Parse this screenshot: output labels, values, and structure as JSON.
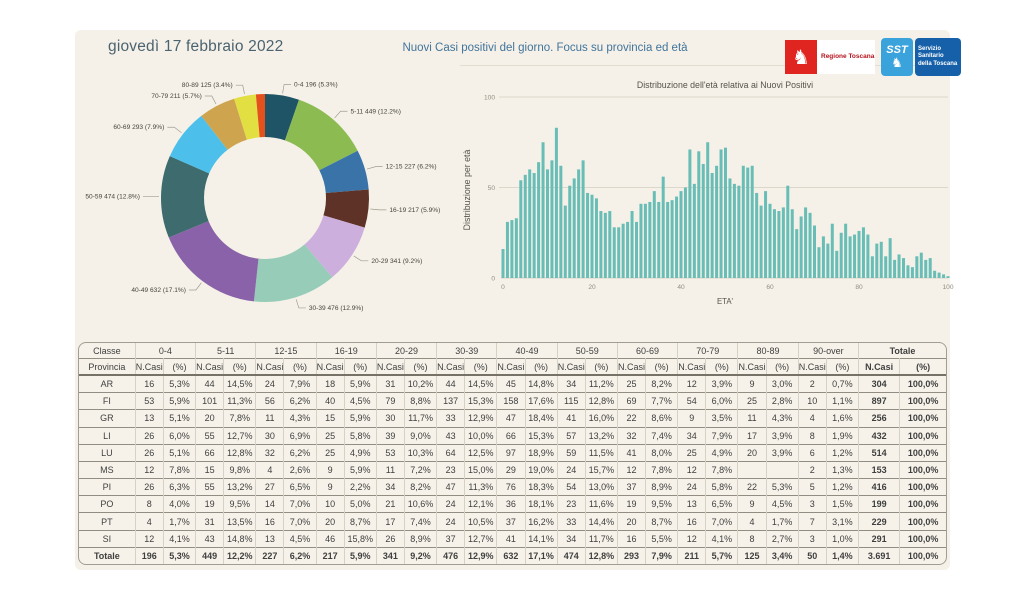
{
  "header": {
    "date_title": "giovedì 17 febbraio 2022",
    "main_title": "Nuovi Casi positivi del giorno. Focus su provincia ed età",
    "logo_regione": {
      "name": "Regione Toscana",
      "color": "#e02521"
    },
    "logo_sst": {
      "acronym": "SST",
      "name": "Servizio Sanitario della Toscana",
      "light_color": "#3ba3dc",
      "dark_color": "#1560a8"
    }
  },
  "chart_data": [
    {
      "type": "pie",
      "title": "",
      "categories": [
        "0-4",
        "5-11",
        "12-15",
        "16-19",
        "20-29",
        "30-39",
        "40-49",
        "50-59",
        "60-69",
        "70-79",
        "80-89",
        "90-over"
      ],
      "values": [
        196,
        449,
        227,
        217,
        341,
        476,
        632,
        474,
        293,
        211,
        125,
        50
      ],
      "percents": [
        5.3,
        12.2,
        6.2,
        5.9,
        9.2,
        12.9,
        17.1,
        12.8,
        7.9,
        5.7,
        3.4,
        1.4
      ],
      "labels": [
        "0-4 196 (5.3%)",
        "5-11 449 (12.2%)",
        "12-15 227 (6.2%)",
        "16-19 217 (5.9%)",
        "20-29 341 (9.2%)",
        "30-39 476 (12.9%)",
        "40-49 632 (17.1%)",
        "50-59 474 (12.8%)",
        "60-69 293 (7.9%)",
        "70-79 211 (5.7%)",
        "80-89 125 (3.4%)",
        null
      ],
      "colors": [
        "#1e5465",
        "#8cbb52",
        "#3a73a8",
        "#5e3226",
        "#cdafdd",
        "#97ccb8",
        "#8a62a9",
        "#3d6b6e",
        "#4cc0ea",
        "#cfa44f",
        "#e2df42",
        "#e5511d"
      ],
      "donut": true
    },
    {
      "type": "bar",
      "title": "Distribuzione dell'età relativa ai Nuovi Positivi",
      "xlabel": "ETA'",
      "ylabel": "Distribuzione per età",
      "x_start": 0,
      "x_end": 100,
      "values": [
        16,
        31,
        32,
        33,
        54,
        57,
        60,
        58,
        64,
        75,
        60,
        65,
        83,
        62,
        40,
        51,
        55,
        60,
        65,
        47,
        46,
        44,
        37,
        36,
        37,
        28,
        28,
        30,
        31,
        37,
        31,
        41,
        41,
        42,
        48,
        42,
        56,
        42,
        43,
        45,
        48,
        50,
        71,
        52,
        70,
        63,
        75,
        58,
        62,
        71,
        72,
        55,
        52,
        51,
        62,
        61,
        62,
        47,
        40,
        48,
        41,
        38,
        37,
        39,
        51,
        38,
        27,
        34,
        39,
        36,
        29,
        17,
        23,
        19,
        30,
        15,
        25,
        30,
        23,
        24,
        26,
        28,
        24,
        12,
        19,
        20,
        12,
        22,
        10,
        13,
        11,
        7,
        6,
        12,
        14,
        10,
        11,
        4,
        3,
        2,
        1
      ],
      "ylim": [
        0,
        100
      ],
      "yticks": [
        0,
        50,
        100
      ],
      "xticks": [
        0,
        20,
        40,
        60,
        80,
        100
      ],
      "bar_color": "#68bdb6",
      "grid": true
    }
  ],
  "table": {
    "corner_top": "Classe",
    "corner_bottom": "Provincia",
    "groups": [
      "0-4",
      "5-11",
      "12-15",
      "16-19",
      "20-29",
      "30-39",
      "40-49",
      "50-59",
      "60-69",
      "70-79",
      "80-89",
      "90-over",
      "Totale"
    ],
    "subheaders": [
      "N.Casi",
      "(%)"
    ],
    "rows": [
      {
        "label": "AR",
        "cells": [
          "16",
          "5,3%",
          "44",
          "14,5%",
          "24",
          "7,9%",
          "18",
          "5,9%",
          "31",
          "10,2%",
          "44",
          "14,5%",
          "45",
          "14,8%",
          "34",
          "11,2%",
          "25",
          "8,2%",
          "12",
          "3,9%",
          "9",
          "3,0%",
          "2",
          "0,7%",
          "304",
          "100,0%"
        ]
      },
      {
        "label": "FI",
        "cells": [
          "53",
          "5,9%",
          "101",
          "11,3%",
          "56",
          "6,2%",
          "40",
          "4,5%",
          "79",
          "8,8%",
          "137",
          "15,3%",
          "158",
          "17,6%",
          "115",
          "12,8%",
          "69",
          "7,7%",
          "54",
          "6,0%",
          "25",
          "2,8%",
          "10",
          "1,1%",
          "897",
          "100,0%"
        ]
      },
      {
        "label": "GR",
        "cells": [
          "13",
          "5,1%",
          "20",
          "7,8%",
          "11",
          "4,3%",
          "15",
          "5,9%",
          "30",
          "11,7%",
          "33",
          "12,9%",
          "47",
          "18,4%",
          "41",
          "16,0%",
          "22",
          "8,6%",
          "9",
          "3,5%",
          "11",
          "4,3%",
          "4",
          "1,6%",
          "256",
          "100,0%"
        ]
      },
      {
        "label": "LI",
        "cells": [
          "26",
          "6,0%",
          "55",
          "12,7%",
          "30",
          "6,9%",
          "25",
          "5,8%",
          "39",
          "9,0%",
          "43",
          "10,0%",
          "66",
          "15,3%",
          "57",
          "13,2%",
          "32",
          "7,4%",
          "34",
          "7,9%",
          "17",
          "3,9%",
          "8",
          "1,9%",
          "432",
          "100,0%"
        ]
      },
      {
        "label": "LU",
        "cells": [
          "26",
          "5,1%",
          "66",
          "12,8%",
          "32",
          "6,2%",
          "25",
          "4,9%",
          "53",
          "10,3%",
          "64",
          "12,5%",
          "97",
          "18,9%",
          "59",
          "11,5%",
          "41",
          "8,0%",
          "25",
          "4,9%",
          "20",
          "3,9%",
          "6",
          "1,2%",
          "514",
          "100,0%"
        ]
      },
      {
        "label": "MS",
        "cells": [
          "12",
          "7,8%",
          "15",
          "9,8%",
          "4",
          "2,6%",
          "9",
          "5,9%",
          "11",
          "7,2%",
          "23",
          "15,0%",
          "29",
          "19,0%",
          "24",
          "15,7%",
          "12",
          "7,8%",
          "12",
          "7,8%",
          "",
          "",
          "2",
          "1,3%",
          "153",
          "100,0%"
        ]
      },
      {
        "label": "PI",
        "cells": [
          "26",
          "6,3%",
          "55",
          "13,2%",
          "27",
          "6,5%",
          "9",
          "2,2%",
          "34",
          "8,2%",
          "47",
          "11,3%",
          "76",
          "18,3%",
          "54",
          "13,0%",
          "37",
          "8,9%",
          "24",
          "5,8%",
          "22",
          "5,3%",
          "5",
          "1,2%",
          "416",
          "100,0%"
        ]
      },
      {
        "label": "PO",
        "cells": [
          "8",
          "4,0%",
          "19",
          "9,5%",
          "14",
          "7,0%",
          "10",
          "5,0%",
          "21",
          "10,6%",
          "24",
          "12,1%",
          "36",
          "18,1%",
          "23",
          "11,6%",
          "19",
          "9,5%",
          "13",
          "6,5%",
          "9",
          "4,5%",
          "3",
          "1,5%",
          "199",
          "100,0%"
        ]
      },
      {
        "label": "PT",
        "cells": [
          "4",
          "1,7%",
          "31",
          "13,5%",
          "16",
          "7,0%",
          "20",
          "8,7%",
          "17",
          "7,4%",
          "24",
          "10,5%",
          "37",
          "16,2%",
          "33",
          "14,4%",
          "20",
          "8,7%",
          "16",
          "7,0%",
          "4",
          "1,7%",
          "7",
          "3,1%",
          "229",
          "100,0%"
        ]
      },
      {
        "label": "SI",
        "cells": [
          "12",
          "4,1%",
          "43",
          "14,8%",
          "13",
          "4,5%",
          "46",
          "15,8%",
          "26",
          "8,9%",
          "37",
          "12,7%",
          "41",
          "14,1%",
          "34",
          "11,7%",
          "16",
          "5,5%",
          "12",
          "4,1%",
          "8",
          "2,7%",
          "3",
          "1,0%",
          "291",
          "100,0%"
        ]
      }
    ],
    "total_row": {
      "label": "Totale",
      "cells": [
        "196",
        "5,3%",
        "449",
        "12,2%",
        "227",
        "6,2%",
        "217",
        "5,9%",
        "341",
        "9,2%",
        "476",
        "12,9%",
        "632",
        "17,1%",
        "474",
        "12,8%",
        "293",
        "7,9%",
        "211",
        "5,7%",
        "125",
        "3,4%",
        "50",
        "1,4%",
        "3.691",
        "100,0%"
      ]
    }
  },
  "colors": {
    "panel_bg": "#f5f1e8",
    "title_blue": "#41749c",
    "date_slate": "#4b6370",
    "grid_line": "#dcd7cb",
    "axis_text": "#908d82",
    "label_text": "#55534a"
  }
}
